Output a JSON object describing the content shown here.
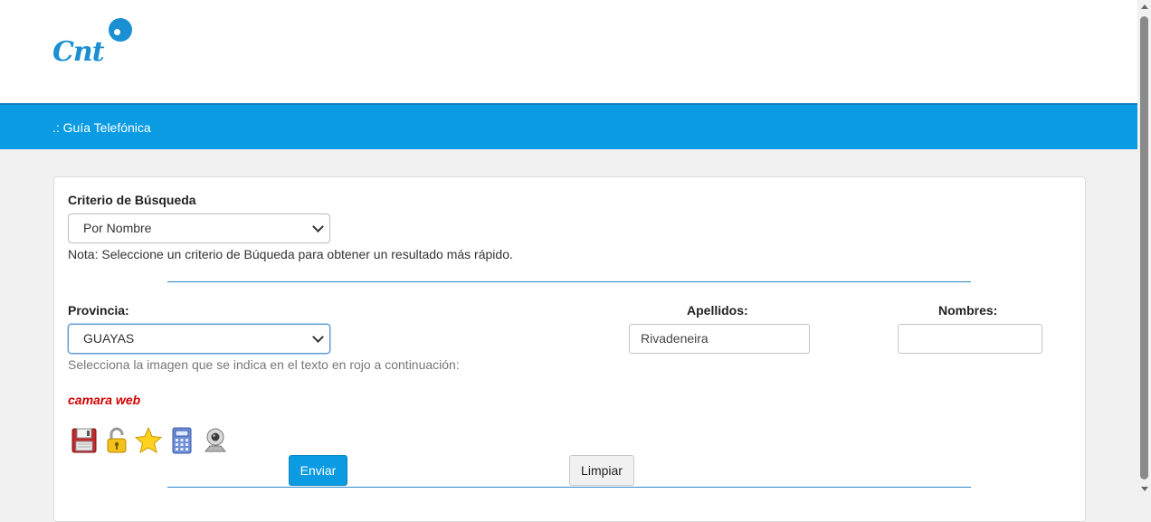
{
  "logo": {
    "text": "Cnt",
    "icon": "cnt-logo"
  },
  "nav": {
    "title": ".: Guía Telefónica"
  },
  "search": {
    "criteria_label": "Criterio de Búsqueda",
    "criteria_value": "Por Nombre",
    "note": "Nota: Seleccione un criterio de Búqueda para obtener un resultado más rápido."
  },
  "form": {
    "provincia_label": "Provincia:",
    "provincia_value": "GUAYAS",
    "apellidos_label": "Apellidos:",
    "apellidos_value": "Rivadeneira",
    "nombres_label": "Nombres:",
    "nombres_value": "",
    "captcha_instruction": "Selecciona la imagen que se indica en el texto en rojo a continuación:",
    "captcha_word": "camara web",
    "captcha_icons": [
      "floppy-disk-icon",
      "padlock-icon",
      "star-icon",
      "calculator-icon",
      "webcam-icon"
    ]
  },
  "buttons": {
    "submit": "Enviar",
    "clear": "Limpiar"
  },
  "colors": {
    "brand": "#0a9be3",
    "captcha": "#d40000",
    "logo": "#1a8fd1"
  }
}
